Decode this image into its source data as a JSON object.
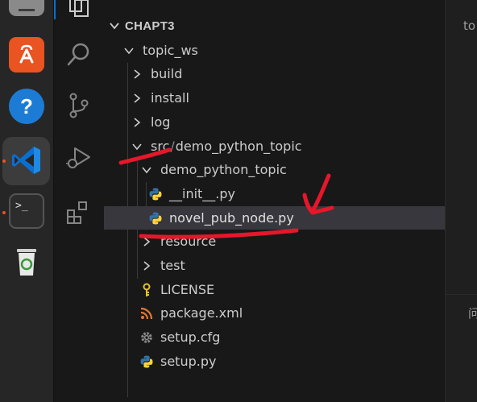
{
  "explorer": {
    "section_title": "CHAPT3",
    "tree": {
      "topic_ws": "topic_ws",
      "build": "build",
      "install": "install",
      "log": "log",
      "src": "src",
      "src_sep": "/",
      "demo_python_topic": "demo_python_topic",
      "demo_python_topic_pkg": "demo_python_topic",
      "init_py": "__init__.py",
      "novel_pub_node": "novel_pub_node.py",
      "resource": "resource",
      "test": "test",
      "license": "LICENSE",
      "package_xml": "package.xml",
      "setup_cfg": "setup.cfg",
      "setup_py": "setup.py"
    }
  },
  "editor": {
    "snippet_top": "to",
    "snippet_bottom": "问"
  },
  "icons": {
    "files": "files-icon",
    "search": "search-icon",
    "source_control": "source-control-icon",
    "run_debug": "run-debug-icon",
    "extensions": "extensions-icon",
    "python_file": "python-file-icon",
    "license_file": "license-key-icon",
    "xml_file": "rss-xml-icon",
    "cfg_file": "gear-icon"
  },
  "colors": {
    "selected_row": "#37373d",
    "annotation": "#e8162a",
    "vscode_blue": "#0a6fd1",
    "ubuntu_orange": "#e95420",
    "python_blue": "#3572a5",
    "python_yellow": "#ffd43b"
  }
}
